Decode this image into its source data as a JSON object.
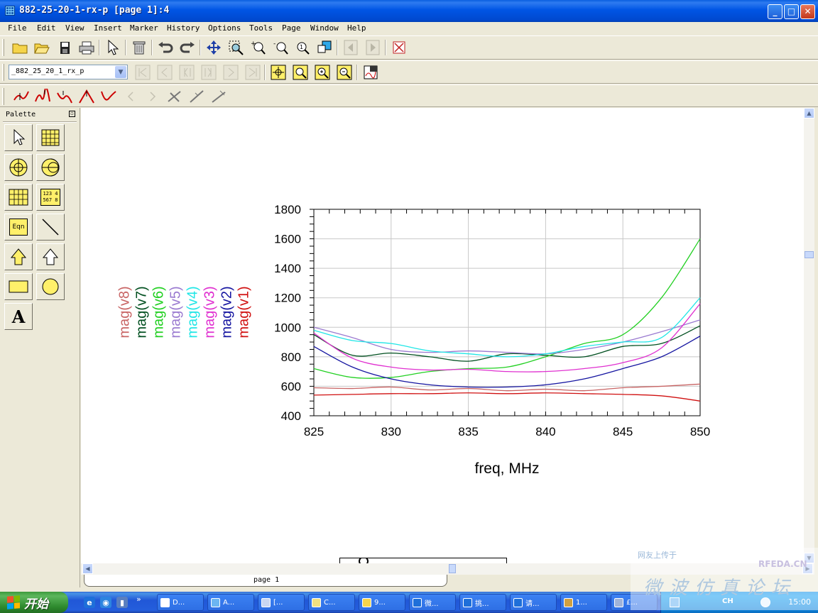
{
  "window": {
    "title": "882-25-20-1-rx-p [page 1]:4",
    "minimize": "_",
    "maximize": "□",
    "close": "✕"
  },
  "menu": [
    "File",
    "Edit",
    "View",
    "Insert",
    "Marker",
    "History",
    "Options",
    "Tools",
    "Page",
    "Window",
    "Help"
  ],
  "toolbar2": {
    "design_select": "_882_25_20_1_rx_p"
  },
  "palette": {
    "title": "Palette",
    "eqn_label": "Eqn",
    "list_label_1": "123 4",
    "list_label_2": "567 8",
    "text_tool": "A"
  },
  "page_tab": "page 1",
  "chart_data": {
    "type": "line",
    "xlabel": "freq, MHz",
    "ylabel": "",
    "xlim": [
      825,
      850
    ],
    "ylim": [
      400,
      1800
    ],
    "xticks": [
      825,
      830,
      835,
      840,
      845,
      850
    ],
    "yticks": [
      400,
      600,
      800,
      1000,
      1200,
      1400,
      1600,
      1800
    ],
    "x": [
      825,
      827.5,
      830,
      832.5,
      835,
      837.5,
      840,
      842.5,
      845,
      847.5,
      850
    ],
    "series": [
      {
        "name": "mag(v8)",
        "color": "#C86464",
        "values": [
          590,
          585,
          595,
          575,
          585,
          570,
          580,
          570,
          590,
          600,
          615
        ]
      },
      {
        "name": "mag(v7)",
        "color": "#004F1F",
        "values": [
          950,
          810,
          825,
          800,
          770,
          820,
          810,
          800,
          870,
          890,
          1010
        ]
      },
      {
        "name": "mag(v6)",
        "color": "#22D022",
        "values": [
          720,
          660,
          660,
          700,
          720,
          730,
          800,
          890,
          950,
          1200,
          1600
        ]
      },
      {
        "name": "mag(v5)",
        "color": "#9A7AD0",
        "values": [
          1000,
          930,
          850,
          830,
          840,
          830,
          820,
          850,
          900,
          970,
          1050
        ]
      },
      {
        "name": "mag(v4)",
        "color": "#20E6E6",
        "values": [
          980,
          910,
          890,
          840,
          820,
          800,
          820,
          870,
          900,
          930,
          1200
        ]
      },
      {
        "name": "mag(v3)",
        "color": "#E030D0",
        "values": [
          960,
          790,
          730,
          710,
          715,
          700,
          700,
          720,
          760,
          860,
          1160
        ]
      },
      {
        "name": "mag(v2)",
        "color": "#1414A0",
        "values": [
          870,
          730,
          650,
          610,
          595,
          595,
          610,
          650,
          720,
          800,
          940
        ]
      },
      {
        "name": "mag(v1)",
        "color": "#D01010",
        "values": [
          540,
          545,
          550,
          550,
          555,
          550,
          555,
          550,
          545,
          535,
          500
        ]
      }
    ]
  },
  "taskbar": {
    "start_label": "开始",
    "tasks": [
      "D...",
      "A...",
      "[...",
      "C...",
      "9...",
      "微...",
      "挑...",
      "请...",
      "1...",
      "£..."
    ],
    "tray_lang": "CH",
    "clock": "15:00"
  },
  "watermark": {
    "line1": "网友上传于",
    "site": "RFEDA.CN",
    "line2": "微波仿真论坛"
  }
}
